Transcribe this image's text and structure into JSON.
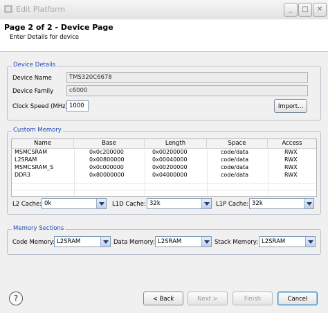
{
  "window": {
    "title": "Edit Platform",
    "controls": {
      "minimize": "_",
      "maximize": "□",
      "close": "✕"
    }
  },
  "header": {
    "title": "Page 2 of 2 - Device Page",
    "subtitle": "Enter Details for device"
  },
  "device_details": {
    "legend": "Device Details",
    "device_name_label": "Device Name",
    "device_name_value": "TMS320C6678",
    "device_family_label": "Device Family",
    "device_family_value": "c6000",
    "clock_speed_label": "Clock Speed (MHz)",
    "clock_speed_value": "1000",
    "import_button": "Import..."
  },
  "custom_memory": {
    "legend": "Custom Memory",
    "columns": [
      "Name",
      "Base",
      "Length",
      "Space",
      "Access"
    ],
    "rows": [
      [
        "MSMCSRAM",
        "0x0c200000",
        "0x00200000",
        "code/data",
        "RWX"
      ],
      [
        "L2SRAM",
        "0x00800000",
        "0x00040000",
        "code/data",
        "RWX"
      ],
      [
        "MSMCSRAM_S",
        "0x0c000000",
        "0x00200000",
        "code/data",
        "RWX"
      ],
      [
        "DDR3",
        "0x80000000",
        "0x04000000",
        "code/data",
        "RWX"
      ]
    ],
    "l2_cache_label": "L2 Cache:",
    "l2_cache_value": "0k",
    "l1d_cache_label": "L1D Cache:",
    "l1d_cache_value": "32k",
    "l1p_cache_label": "L1P Cache:",
    "l1p_cache_value": "32k"
  },
  "memory_sections": {
    "legend": "Memory Sections",
    "code_memory_label": "Code Memory:",
    "code_memory_value": "L2SRAM",
    "data_memory_label": "Data Memory:",
    "data_memory_value": "L2SRAM",
    "stack_memory_label": "Stack Memory:",
    "stack_memory_value": "L2SRAM"
  },
  "footer": {
    "help_glyph": "?",
    "back_button": "< Back",
    "next_button": "Next >",
    "finish_button": "Finish",
    "cancel_button": "Cancel"
  },
  "colors": {
    "legend_text": "#1a46b4",
    "group_border": "#b8c0cc",
    "window_bg": "#f0f0f0"
  }
}
